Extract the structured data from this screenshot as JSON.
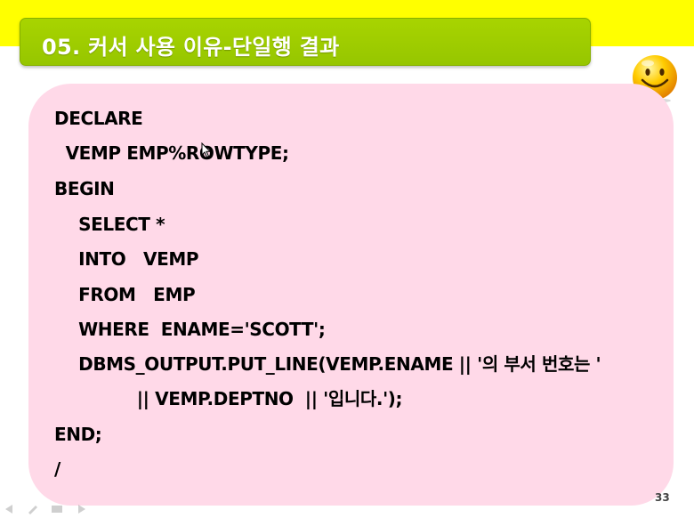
{
  "slide": {
    "title": "05. 커서 사용 이유-단일행 결과",
    "page_number": "33",
    "code_lines": [
      "DECLARE",
      " VEMP EMP%ROWTYPE;",
      "BEGIN",
      "  SELECT *",
      "  INTO   VEMP",
      "  FROM   EMP",
      "  WHERE  ENAME='SCOTT';",
      "  DBMS_OUTPUT.PUT_LINE(VEMP.ENAME || '의 부서 번호는 '",
      "            || VEMP.DEPTNO  || '입니다.');",
      "END;",
      "/"
    ]
  },
  "colors": {
    "top_band": "#ffff00",
    "title_bar": "#9ccc00",
    "code_panel": "#ffd9e8",
    "title_text": "#ffffff",
    "code_text": "#000000"
  },
  "icons": {
    "decoration": "smiley-face-icon",
    "pointer": "mouse-cursor-icon"
  }
}
